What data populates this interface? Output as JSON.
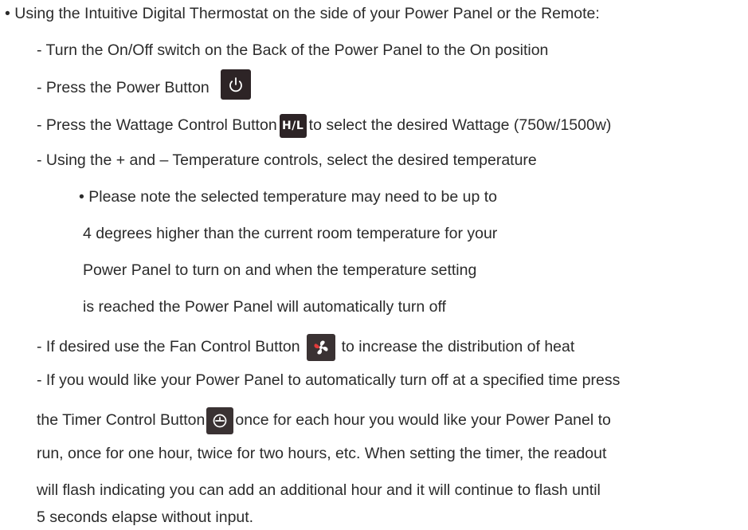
{
  "instructions": {
    "intro": "• Using the Intuitive Digital Thermostat on the side of your Power Panel or the Remote:",
    "step_switch": "- Turn the On/Off switch on the Back of the Power Panel to the On position",
    "step_power": "- Press the Power Button",
    "step_wattage_before": "- Press the Wattage Control Button",
    "wattage_icon_label": "H/L",
    "step_wattage_after": "to select the desired Wattage (750w/1500w)",
    "step_temperature": "-  Using the + and – Temperature controls, select the desired temperature",
    "note_1": "• Please note the selected temperature may need to be up to",
    "note_2": "4 degrees higher than the current room temperature for your",
    "note_3": "Power Panel to turn on and when the temperature setting",
    "note_4": "is reached the Power Panel will automatically turn off",
    "step_fan_before": "- If desired use the Fan Control Button",
    "step_fan_after": "to increase the distribution of heat",
    "timer_1": "- If you would like your Power Panel to automatically turn off at a specified time press",
    "timer_2_before": "the Timer Control Button",
    "timer_2_after": "once for each hour you would like your Power Panel to",
    "timer_3": "run, once for one hour, twice for two hours, etc. When setting the timer, the readout",
    "timer_4": "will flash indicating you can add an additional hour and it will continue to flash until",
    "timer_5": "5 seconds elapse without input."
  },
  "icons": {
    "power": "power-icon",
    "wattage": "wattage-hl-icon",
    "fan": "fan-icon",
    "timer": "timer-icon"
  },
  "colors": {
    "text": "#2b2b2b",
    "icon_bg": "#2d2426",
    "icon_fg": "#ffffff",
    "fan_red": "#e23b3b"
  }
}
